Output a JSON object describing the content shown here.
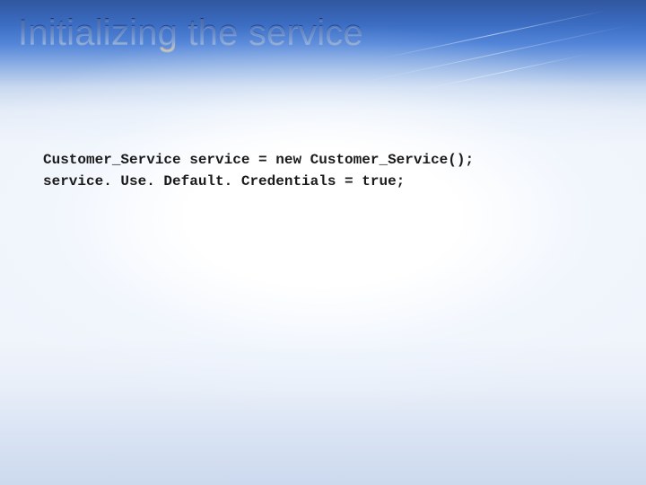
{
  "slide": {
    "title": "Initializing the service",
    "code": {
      "line1": "Customer_Service service = new Customer_Service();",
      "line2": "service. Use. Default. Credentials = true;"
    }
  }
}
